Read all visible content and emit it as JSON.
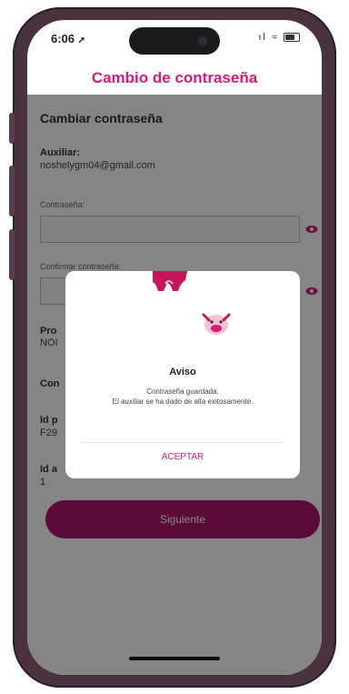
{
  "status_bar": {
    "time": "6:06",
    "location_arrow": "➚",
    "signal_wifi": "ıl ≈"
  },
  "header": {
    "title": "Cambio de contraseña"
  },
  "form": {
    "section_title": "Cambiar contraseña",
    "auxiliar_label": "Auxiliar:",
    "auxiliar_value": "noshelygm04@gmail.com",
    "password_label": "Contraseña:",
    "password_value": "",
    "confirm_label": "Confirmar contraseña:",
    "confirm_value": "",
    "trunc_1_label": "Pro",
    "trunc_1_value": "NOI",
    "trunc_2_label": "Con",
    "trunc_3_label": "Id p",
    "trunc_3_value": "F29",
    "trunc_4_label": "Id a",
    "trunc_4_value": "1",
    "submit_label": "Siguiente"
  },
  "dialog": {
    "title": "Aviso",
    "message_line1": "Contraseña guardada.",
    "message_line2": "El auxiliar se ha dado de alta exitosamente.",
    "accept_label": "ACEPTAR"
  },
  "colors": {
    "accent": "#d81b78",
    "button": "#b0156a",
    "overlay": "rgba(0,0,0,0.48)"
  },
  "icons": {
    "password_visibility": "eye-icon",
    "confirm_visibility": "eye-icon",
    "dialog_illustration": "cow-illustration"
  }
}
